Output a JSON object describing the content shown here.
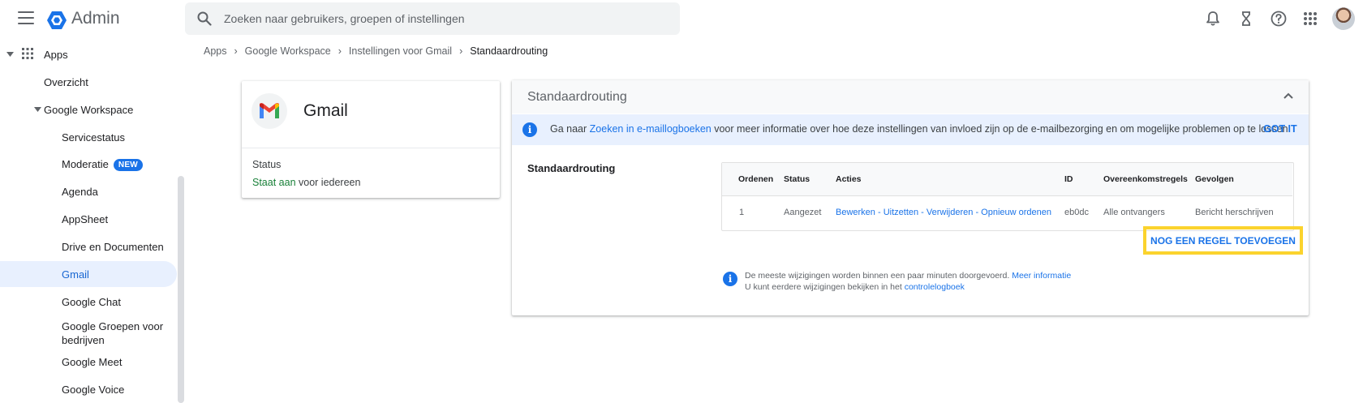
{
  "app": {
    "title": "Admin"
  },
  "search": {
    "placeholder": "Zoeken naar gebruikers, groepen of instellingen"
  },
  "topbar_icons": [
    "bell-icon",
    "hourglass-icon",
    "help-icon",
    "apps-grid-icon",
    "avatar"
  ],
  "sidebar": {
    "apps_label": "Apps",
    "items": [
      {
        "label": "Overzicht"
      },
      {
        "label": "Google Workspace"
      },
      {
        "label": "Servicestatus"
      },
      {
        "label": "Moderatie",
        "badge": "NEW"
      },
      {
        "label": "Agenda"
      },
      {
        "label": "AppSheet"
      },
      {
        "label": "Drive en Documenten"
      },
      {
        "label": "Gmail",
        "active": true
      },
      {
        "label": "Google Chat"
      },
      {
        "label": "Google Groepen voor",
        "label2": "bedrijven"
      },
      {
        "label": "Google Meet"
      },
      {
        "label": "Google Voice"
      }
    ]
  },
  "breadcrumb": [
    "Apps",
    "Google Workspace",
    "Instellingen voor Gmail",
    "Standaardrouting"
  ],
  "gmail_card": {
    "title": "Gmail",
    "status_label": "Status",
    "status_value": "Staat aan",
    "status_suffix": "voor iedereen"
  },
  "routing_card": {
    "title": "Standaardrouting",
    "banner": {
      "prefix": "Ga naar",
      "link": "Zoeken in e-maillogboeken",
      "suffix": "voor meer informatie over hoe deze instellingen van invloed zijn op de e-mailbezorging en om mogelijke problemen op te lossen.",
      "dismiss": "GOT IT"
    },
    "section_label": "Standaardrouting",
    "table": {
      "headers": [
        "Ordenen",
        "Status",
        "Acties",
        "ID",
        "Overeenkomstregels",
        "Gevolgen"
      ],
      "row": {
        "order": "1",
        "status": "Aangezet",
        "actions": [
          "Bewerken",
          "Uitzetten",
          "Verwijderen",
          "Opnieuw ordenen"
        ],
        "action_sep": " - ",
        "id": "eb0dc",
        "match": "Alle ontvangers",
        "effect": "Bericht herschrijven"
      }
    },
    "add_rule": "NOG EEN REGEL TOEVOEGEN",
    "note": {
      "line1": "De meeste wijzigingen worden binnen een paar minuten doorgevoerd.",
      "line1_link": "Meer informatie",
      "line2": "U kunt eerdere wijzigingen bekijken in het",
      "line2_link": "controlelogboek"
    }
  },
  "colors": {
    "accent": "#1a73e8",
    "highlight": "#fbd32d",
    "active_bg": "#e8f0fe",
    "status_green": "#188038"
  }
}
